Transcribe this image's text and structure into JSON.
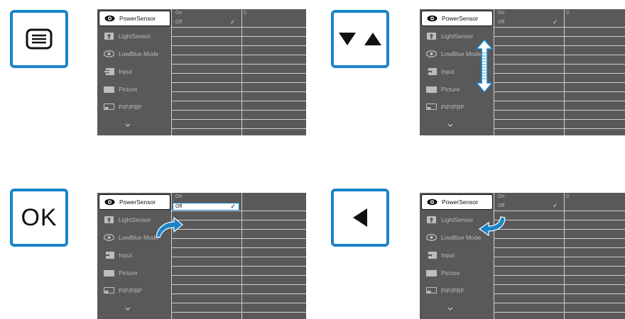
{
  "keys": {
    "menu_icon": "menu-list-icon",
    "updown_icon": "up-down-arrow-icon",
    "ok_label": "OK",
    "left_icon": "left-arrow-icon"
  },
  "osd": {
    "menu_items": [
      {
        "label": "PowerSensor",
        "icon": "eye-icon"
      },
      {
        "label": "LightSensor",
        "icon": "light-sensor-icon"
      },
      {
        "label": "LowBlue Mode",
        "icon": "lowblue-eye-icon"
      },
      {
        "label": "Input",
        "icon": "input-icon"
      },
      {
        "label": "Picture",
        "icon": "picture-icon"
      },
      {
        "label": "PIP/PBP",
        "icon": "pip-icon"
      }
    ],
    "options": [
      "On",
      "Off"
    ],
    "value_label": "0",
    "check_mark": "✓"
  },
  "colors": {
    "accent": "#1a84c8",
    "osd_bg": "#595959"
  }
}
